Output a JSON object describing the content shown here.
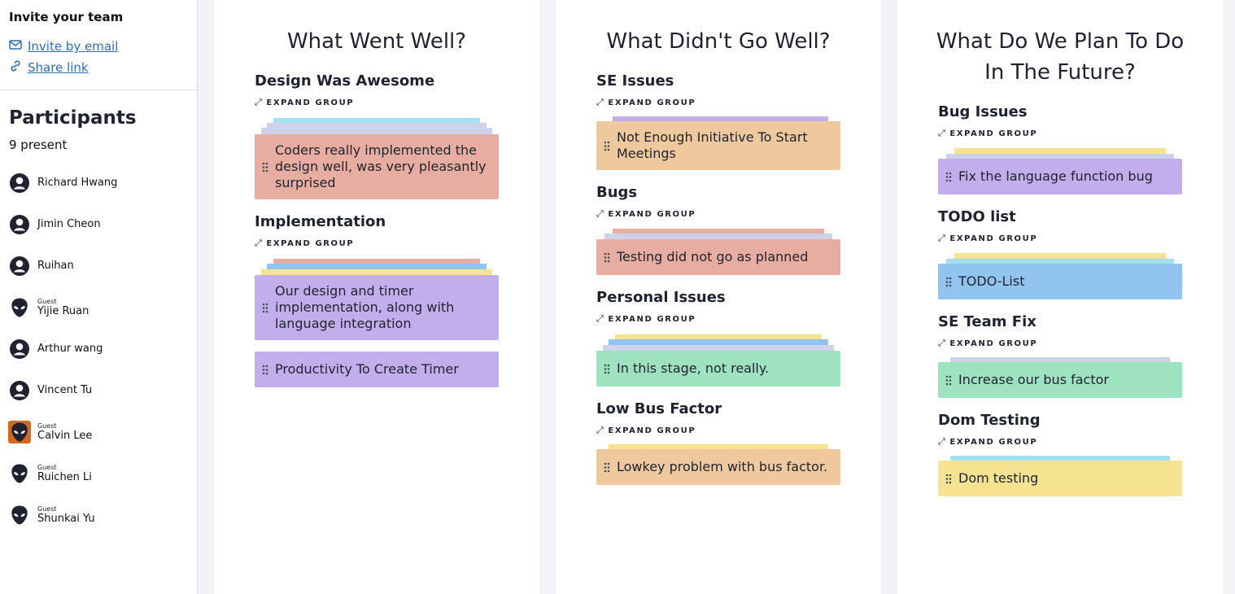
{
  "sidebar": {
    "invite_title": "Invite your team",
    "invite_email": "Invite by email",
    "share_link": "Share link",
    "participants_title": "Participants",
    "present_count": "9 present",
    "participants": [
      {
        "name": "Richard Hwang",
        "guest": "",
        "avatar": "user-avatar-icon"
      },
      {
        "name": "Jimin Cheon",
        "guest": "",
        "avatar": "user-avatar-icon"
      },
      {
        "name": "Ruihan",
        "guest": "",
        "avatar": "user-avatar-icon"
      },
      {
        "name": "Yijie Ruan",
        "guest": "Guest",
        "avatar": "alien-avatar-icon"
      },
      {
        "name": "Arthur wang",
        "guest": "",
        "avatar": "user-avatar-icon"
      },
      {
        "name": "Vincent Tu",
        "guest": "",
        "avatar": "user-avatar-icon"
      },
      {
        "name": "Calvin Lee",
        "guest": "Guest",
        "avatar": "alien-avatar-icon"
      },
      {
        "name": "Ruichen Li",
        "guest": "Guest",
        "avatar": "alien-avatar-icon"
      },
      {
        "name": "Shunkai Yu",
        "guest": "Guest",
        "avatar": "alien-avatar-icon"
      }
    ]
  },
  "expand_label": "EXPAND GROUP",
  "colors": {
    "red": "#e6ada0",
    "purple": "#c2aeea",
    "orange": "#eec99e",
    "green": "#9ee3bf",
    "blue": "#92c4f0",
    "yellow": "#f5e392",
    "cyan": "#a5dff5",
    "lavender": "#cdd2ea"
  },
  "columns": [
    {
      "title_lines": [
        "What Went Well?"
      ],
      "groups": [
        {
          "title": "Design Was Awesome",
          "cards": [
            {
              "text_lines": [
                "Coders really implemented the",
                "design well, was very pleasantly",
                "surprised"
              ],
              "color": "red"
            }
          ]
        },
        {
          "title": "Implementation",
          "cards": [
            {
              "text_lines": [
                "Our design and timer",
                "implementation, along with",
                "language integration"
              ],
              "color": "purple"
            },
            {
              "text_lines": [
                "Productivity To Create Timer"
              ],
              "color": "purple"
            }
          ]
        }
      ]
    },
    {
      "title_lines": [
        "What Didn't Go Well?"
      ],
      "groups": [
        {
          "title": "SE Issues",
          "cards": [
            {
              "text_lines": [
                "Not Enough Initiative To Start",
                "Meetings"
              ],
              "color": "orange"
            }
          ]
        },
        {
          "title": "Bugs",
          "cards": [
            {
              "text_lines": [
                "Testing did not go as planned"
              ],
              "color": "red"
            }
          ]
        },
        {
          "title": "Personal Issues",
          "cards": [
            {
              "text_lines": [
                "In this stage, not really."
              ],
              "color": "green"
            }
          ]
        },
        {
          "title": "Low Bus Factor",
          "cards": [
            {
              "text_lines": [
                "Lowkey problem with bus factor."
              ],
              "color": "orange"
            }
          ]
        }
      ]
    },
    {
      "title_lines": [
        "What Do We Plan To Do",
        "In The Future?"
      ],
      "groups": [
        {
          "title": "Bug Issues",
          "cards": [
            {
              "text_lines": [
                "Fix the language function bug"
              ],
              "color": "purple"
            }
          ]
        },
        {
          "title": "TODO list",
          "cards": [
            {
              "text_lines": [
                "TODO-List"
              ],
              "color": "blue"
            }
          ]
        },
        {
          "title": "SE Team Fix",
          "cards": [
            {
              "text_lines": [
                "Increase our bus factor"
              ],
              "color": "green"
            }
          ]
        },
        {
          "title": "Dom Testing",
          "cards": [
            {
              "text_lines": [
                "Dom testing"
              ],
              "color": "yellow"
            }
          ]
        }
      ]
    }
  ]
}
